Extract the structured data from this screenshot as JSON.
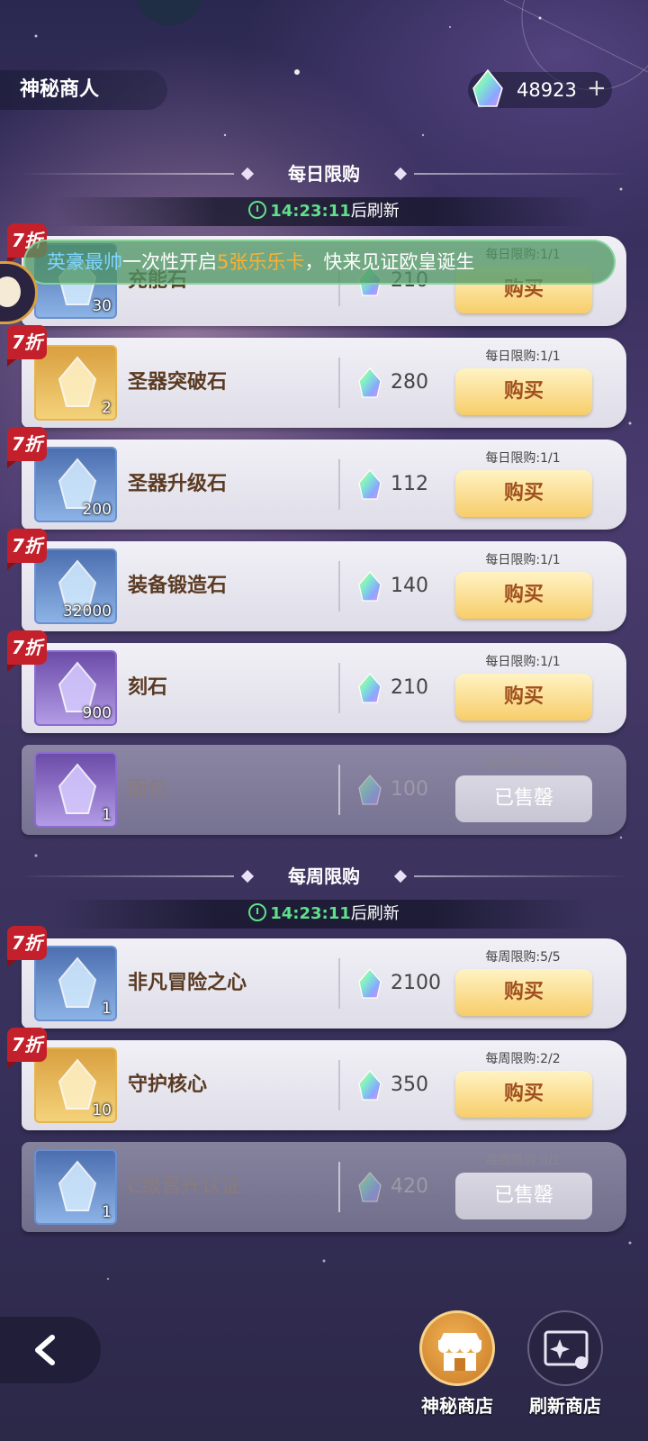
{
  "header": {
    "shop_name": "神秘商人",
    "currency_amount": "48923",
    "currency_plus": "+"
  },
  "marquee": {
    "user": "英豪最帅",
    "part1": "一次性开启",
    "highlight": "5张乐乐卡",
    "part2": "，快来见证欧皇诞生"
  },
  "daily": {
    "title": "每日限购",
    "timer": "14:23:11",
    "timer_suffix": "后刷新",
    "items": [
      {
        "name": "充能石",
        "qty": "30",
        "price": "210",
        "limit": "每日限购:1/1",
        "button": "购买",
        "discount": "7折",
        "frame": "blue"
      },
      {
        "name": "圣器突破石",
        "qty": "2",
        "price": "280",
        "limit": "每日限购:1/1",
        "button": "购买",
        "discount": "7折",
        "frame": "gold"
      },
      {
        "name": "圣器升级石",
        "qty": "200",
        "price": "112",
        "limit": "每日限购:1/1",
        "button": "购买",
        "discount": "7折",
        "frame": "blue"
      },
      {
        "name": "装备锻造石",
        "qty": "32000",
        "price": "140",
        "limit": "每日限购:1/1",
        "button": "购买",
        "discount": "7折",
        "frame": "blue"
      },
      {
        "name": "刻石",
        "qty": "900",
        "price": "210",
        "limit": "每日限购:1/1",
        "button": "购买",
        "discount": "7折",
        "frame": "purple"
      },
      {
        "name": "面包",
        "qty": "1",
        "price": "100",
        "limit": "每日限购:0/9",
        "button": "已售罄",
        "discount": "",
        "frame": "purple"
      }
    ]
  },
  "weekly": {
    "title": "每周限购",
    "timer": "14:23:11",
    "timer_suffix": "后刷新",
    "items": [
      {
        "name": "非凡冒险之心",
        "qty": "1",
        "price": "2100",
        "limit": "每周限购:5/5",
        "button": "购买",
        "discount": "7折",
        "frame": "blue"
      },
      {
        "name": "守护核心",
        "qty": "10",
        "price": "350",
        "limit": "每周限购:2/2",
        "button": "购买",
        "discount": "7折",
        "frame": "gold"
      },
      {
        "name": "C级晋升认证",
        "qty": "1",
        "price": "420",
        "limit": "每周限购:0/1",
        "button": "已售罄",
        "discount": "",
        "frame": "blue"
      }
    ]
  },
  "bottom_nav": {
    "mystic_shop": "神秘商店",
    "refresh_shop": "刷新商店"
  },
  "colors": {
    "accent_green": "#5fe08a",
    "buy_button": "#f7cd6a",
    "discount_red": "#c4202b",
    "brand_gold": "#f0b254"
  },
  "icons": [
    "back-chevron-icon",
    "rainbow-gem-icon",
    "clock-icon",
    "shop-stall-icon",
    "refresh-card-icon"
  ]
}
